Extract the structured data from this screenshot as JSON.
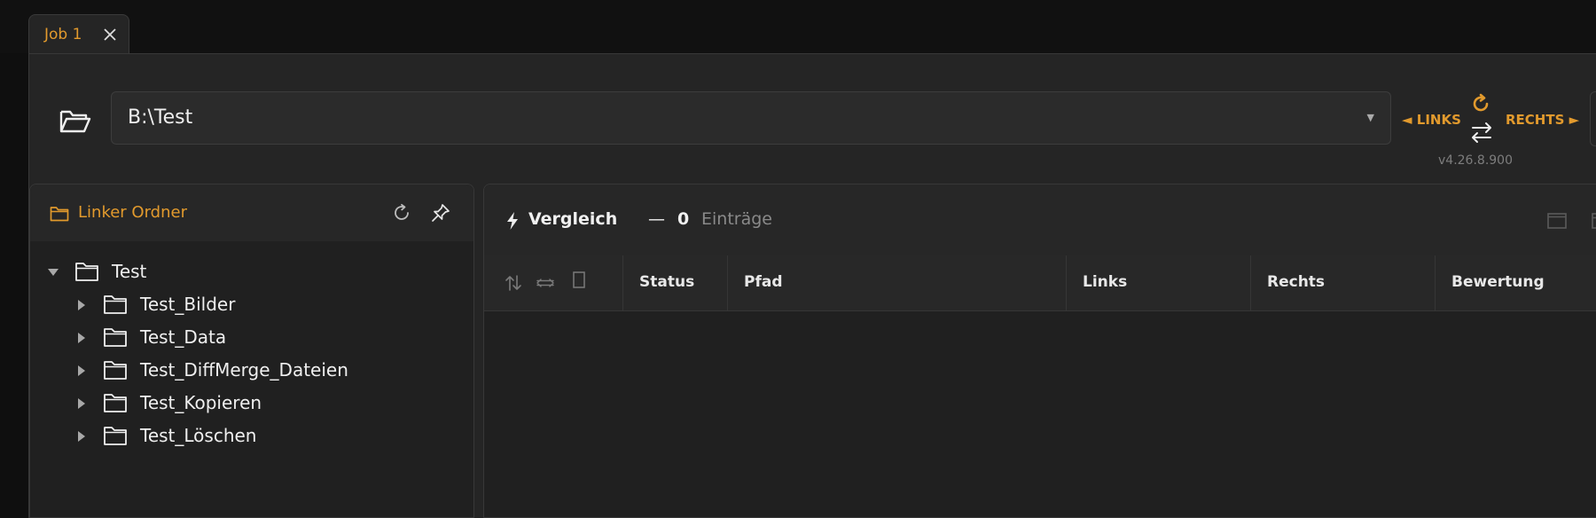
{
  "tabs": [
    {
      "label": "Job 1",
      "active": true
    }
  ],
  "toolbar": {
    "path_value": "B:\\Test",
    "links_label": "◄ LINKS",
    "rechts_label": "RECHTS ►",
    "version": "v4.26.8.900"
  },
  "left_panel": {
    "title": "Linker Ordner",
    "tree": {
      "root": "Test",
      "children": [
        "Test_Bilder",
        "Test_Data",
        "Test_DiffMerge_Dateien",
        "Test_Kopieren",
        "Test_Löschen"
      ]
    }
  },
  "compare_panel": {
    "title": "Vergleich",
    "separator": "—",
    "count": "0",
    "count_unit": "Einträge",
    "columns": [
      "Status",
      "Pfad",
      "Links",
      "Rechts",
      "Bewertung"
    ]
  },
  "colors": {
    "accent": "#e29a2d",
    "background": "#111111",
    "panel": "#202020",
    "header": "#272727"
  }
}
